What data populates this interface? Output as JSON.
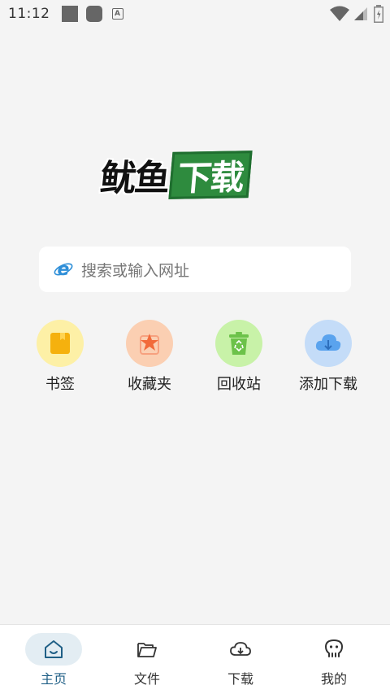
{
  "status_bar": {
    "time": "11:12",
    "a_glyph": "A"
  },
  "logo": {
    "part_dark": "鱿鱼",
    "part_green": "下载"
  },
  "search": {
    "placeholder": "搜索或输入网址",
    "icon": "ie-browser-icon"
  },
  "quick_actions": [
    {
      "label": "书签",
      "icon": "bookmark-icon",
      "bg": "#fdf0a6",
      "fg": "#f5b10e"
    },
    {
      "label": "收藏夹",
      "icon": "favorites-star-icon",
      "bg": "#fbcfb2",
      "fg": "#f26a3a"
    },
    {
      "label": "回收站",
      "icon": "recycle-bin-icon",
      "bg": "#c8f2a8",
      "fg": "#6cc24a"
    },
    {
      "label": "添加下载",
      "icon": "cloud-download-icon",
      "bg": "#c4dcf8",
      "fg": "#5aa3ee"
    }
  ],
  "bottom_nav": [
    {
      "label": "主页",
      "icon": "home-icon",
      "active": true
    },
    {
      "label": "文件",
      "icon": "folder-icon",
      "active": false
    },
    {
      "label": "下载",
      "icon": "cloud-download-nav-icon",
      "active": false
    },
    {
      "label": "我的",
      "icon": "profile-icon",
      "active": false
    }
  ],
  "colors": {
    "accent": "#1f5f86",
    "logo_green": "#2e8b3e",
    "background": "#f4f4f4"
  }
}
